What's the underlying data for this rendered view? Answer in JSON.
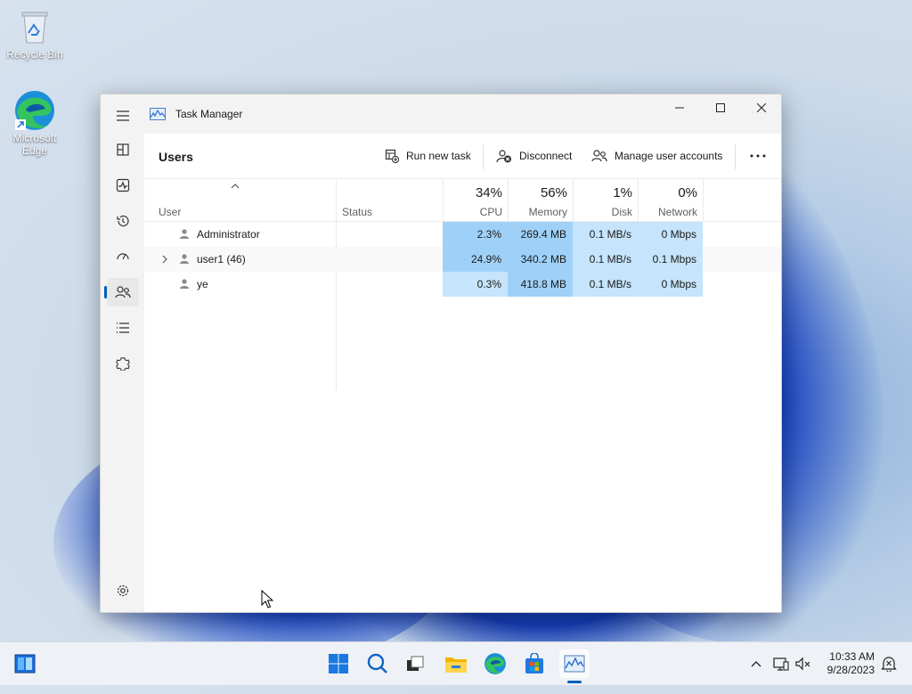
{
  "desktop": {
    "icons": [
      {
        "label": "Recycle Bin",
        "icon": "recycle-bin-icon"
      },
      {
        "label": "Microsoft\nEdge",
        "line1": "Microsoft",
        "line2": "Edge",
        "icon": "edge-icon"
      }
    ]
  },
  "window": {
    "title": "Task Manager",
    "nav_items": [
      "hamburger-icon",
      "processes-icon",
      "performance-icon",
      "app-history-icon",
      "startup-apps-icon",
      "users-icon",
      "details-icon",
      "services-icon",
      "settings-icon"
    ],
    "active_nav": "users"
  },
  "toolbar": {
    "page_title": "Users",
    "run_new_task": "Run new task",
    "disconnect": "Disconnect",
    "manage_user_accounts": "Manage user accounts"
  },
  "columns": {
    "user": "User",
    "status": "Status",
    "cpu": {
      "pct": "34%",
      "label": "CPU"
    },
    "memory": {
      "pct": "56%",
      "label": "Memory"
    },
    "disk": {
      "pct": "1%",
      "label": "Disk"
    },
    "network": {
      "pct": "0%",
      "label": "Network"
    }
  },
  "rows": [
    {
      "name": "Administrator",
      "expandable": false,
      "status": "",
      "cpu": "2.3%",
      "memory": "269.4 MB",
      "disk": "0.1 MB/s",
      "network": "0 Mbps"
    },
    {
      "name": "user1 (46)",
      "expandable": true,
      "status": "",
      "cpu": "24.9%",
      "memory": "340.2 MB",
      "disk": "0.1 MB/s",
      "network": "0.1 Mbps"
    },
    {
      "name": "ye",
      "expandable": false,
      "status": "",
      "cpu": "0.3%",
      "memory": "418.8 MB",
      "disk": "0.1 MB/s",
      "network": "0 Mbps"
    }
  ],
  "heat_colors": {
    "cpu_high": "#9fd1f8",
    "cpu_low": "#c6e4fb",
    "memory": "#9fd1f8",
    "disk": "#c6e4fb",
    "network": "#c6e4fb"
  },
  "taskbar": {
    "apps": [
      "start-icon",
      "search-icon",
      "task-view-icon",
      "file-explorer-icon",
      "edge-icon",
      "store-icon",
      "task-manager-icon"
    ],
    "tray": [
      "chevron-up-icon",
      "network-icon",
      "volume-muted-icon",
      "notification-icon"
    ],
    "time": "10:33 AM",
    "date": "9/28/2023"
  }
}
